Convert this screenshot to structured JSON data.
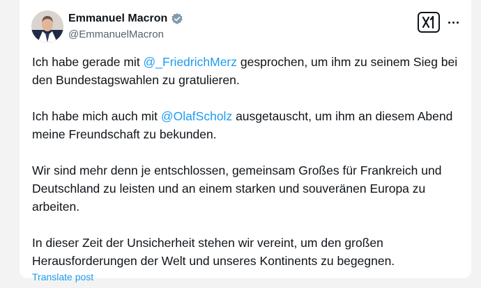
{
  "tweet": {
    "author": {
      "name": "Emmanuel Macron",
      "handle": "@EmmanuelMacron"
    },
    "paragraphs": [
      {
        "parts": [
          {
            "text": "Ich habe gerade mit ",
            "type": "text"
          },
          {
            "text": "@_FriedrichMerz",
            "type": "mention"
          },
          {
            "text": " gesprochen, um ihm zu seinem Sieg bei den Bundestagswahlen zu gratulieren.",
            "type": "text"
          }
        ]
      },
      {
        "parts": [
          {
            "text": "Ich habe mich auch mit ",
            "type": "text"
          },
          {
            "text": "@OlafScholz",
            "type": "mention"
          },
          {
            "text": " ausgetauscht, um ihm an diesem Abend meine Freundschaft zu bekunden.",
            "type": "text"
          }
        ]
      },
      {
        "parts": [
          {
            "text": "Wir sind mehr denn je entschlossen, gemeinsam Großes für Frankreich und Deutschland zu leisten und an einem starken und souveränen Europa zu arbeiten.",
            "type": "text"
          }
        ]
      },
      {
        "parts": [
          {
            "text": "In dieser Zeit der Unsicherheit stehen wir vereint, um den großen Herausforderungen der Welt und unseres Kontinents zu begegnen.",
            "type": "text"
          }
        ]
      }
    ],
    "translate_label": "Translate post"
  },
  "colors": {
    "accent": "#1d9bf0",
    "text": "#0f1419",
    "secondary": "#536471"
  },
  "icons": {
    "verified": "verified-badge-icon",
    "brand": "x-logo-icon",
    "more": "more-options-icon"
  }
}
